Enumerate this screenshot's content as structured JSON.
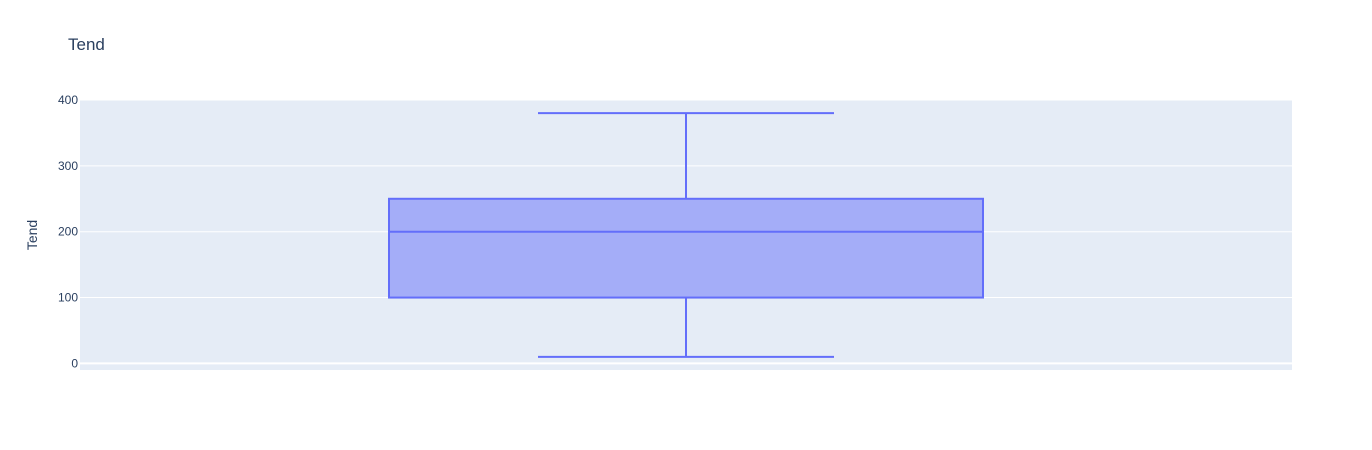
{
  "chart_data": {
    "type": "box",
    "title": "Tend",
    "xlabel": "",
    "ylabel": "Tend",
    "ylim": [
      -10,
      400
    ],
    "y_ticks": [
      0,
      100,
      200,
      300,
      400
    ],
    "grid": true,
    "series": [
      {
        "lowerfence": 10,
        "q1": 100,
        "median": 200,
        "q3": 250,
        "upperfence": 380
      }
    ],
    "colors": {
      "plot_bg": "#e5ecf6",
      "grid": "#ffffff",
      "line": "#636efa",
      "fill": "rgba(99,110,250,0.5)",
      "text": "#2a3f5f"
    }
  }
}
